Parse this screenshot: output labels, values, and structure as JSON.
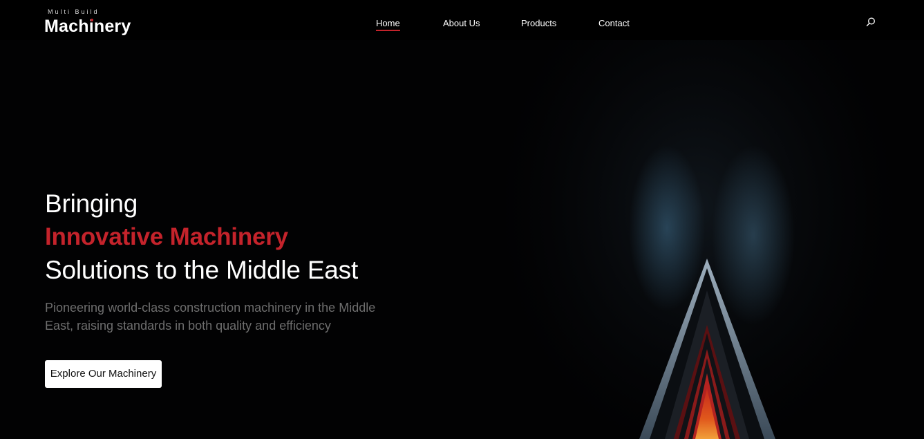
{
  "brand": {
    "tagline": "Multi Build",
    "name": "Machinery"
  },
  "nav": {
    "items": [
      {
        "label": "Home",
        "active": true
      },
      {
        "label": "About Us",
        "active": false
      },
      {
        "label": "Products",
        "active": false
      },
      {
        "label": "Contact",
        "active": false
      }
    ]
  },
  "hero": {
    "line1": "Bringing",
    "line2": "Innovative Machinery",
    "line3": "Solutions to the Middle East",
    "description": "Pioneering world-class construction machinery in the Middle East, raising standards in both quality and efficiency",
    "cta_label": "Explore Our Machinery"
  },
  "icons": {
    "search": "search-icon"
  },
  "colors": {
    "accent": "#c4232b",
    "background": "#020203",
    "header": "#000000"
  }
}
